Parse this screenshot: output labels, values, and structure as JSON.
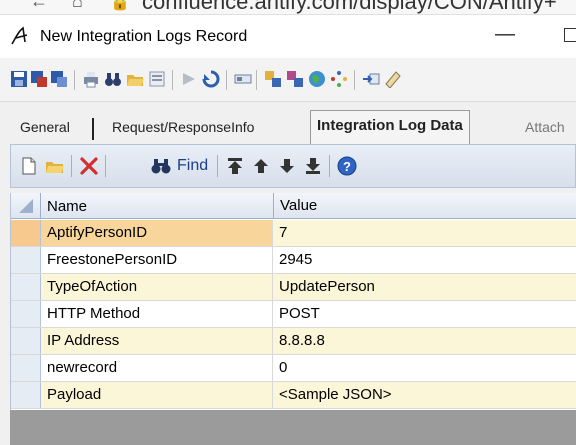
{
  "browser": {
    "url": "confluence.antify.com/display/CON/Antify+"
  },
  "window": {
    "title": "New Integration Logs Record"
  },
  "tabs": [
    {
      "label": "General"
    },
    {
      "label": "Request/ResponseInfo"
    },
    {
      "label": "Integration Log Data"
    },
    {
      "label": "Attach"
    }
  ],
  "subtoolbar": {
    "find_label": "Find"
  },
  "grid": {
    "columns": [
      "Name",
      "Value"
    ],
    "rows": [
      {
        "name": "AptifyPersonID",
        "value": "7"
      },
      {
        "name": "FreestonePersonID",
        "value": "2945"
      },
      {
        "name": "TypeOfAction",
        "value": "UpdatePerson"
      },
      {
        "name": "HTTP Method",
        "value": "POST"
      },
      {
        "name": "IP Address",
        "value": "8.8.8.8"
      },
      {
        "name": "newrecord",
        "value": "0"
      },
      {
        "name": "Payload",
        "value": "<Sample JSON>"
      }
    ]
  },
  "colors": {
    "row_fill": "#fbf6d8",
    "current_row": "#f8d59a",
    "grid_border": "#b5c3d6"
  }
}
